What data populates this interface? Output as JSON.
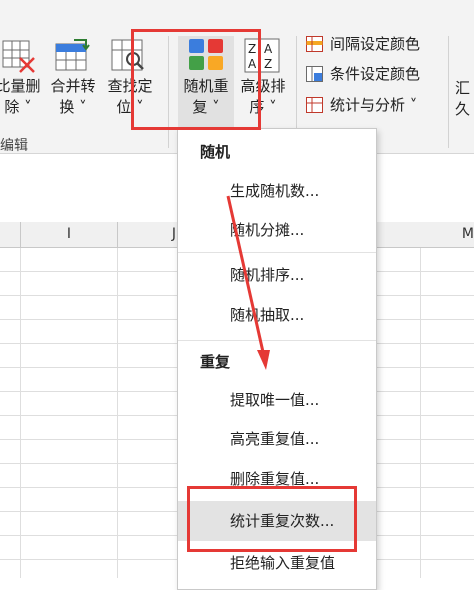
{
  "ribbon": {
    "batch_delete": {
      "line1": "比量删",
      "line2": "除 ˅"
    },
    "merge_convert": {
      "line1": "合并转",
      "line2": "换 ˅"
    },
    "find_locate": {
      "line1": "查找定",
      "line2": "位 ˅"
    },
    "random_repeat": {
      "line1": "随机重",
      "line2": "复 ˅"
    },
    "advanced_sort": {
      "line1": "高级排",
      "line2": "序 ˅"
    },
    "interval_color": "间隔设定颜色",
    "conditional_color": "条件设定颜色",
    "stats_analysis": "统计与分析 ˅",
    "right_edge_label1": "汇",
    "right_edge_label2": "久",
    "group_label": "编辑"
  },
  "columns": [
    "I",
    "J",
    "M"
  ],
  "menu": {
    "section_random": "随机",
    "generate_random": "生成随机数...",
    "random_split": "随机分摊...",
    "random_sort": "随机排序...",
    "random_extract": "随机抽取...",
    "section_repeat": "重复",
    "extract_unique": "提取唯一值...",
    "highlight_dup": "高亮重复值...",
    "delete_dup": "删除重复值...",
    "count_dup": "统计重复次数...",
    "reject_dup_input": "拒绝输入重复值"
  },
  "colors": {
    "accent_red": "#e53935",
    "highlight_bg": "#e3e3e3"
  }
}
